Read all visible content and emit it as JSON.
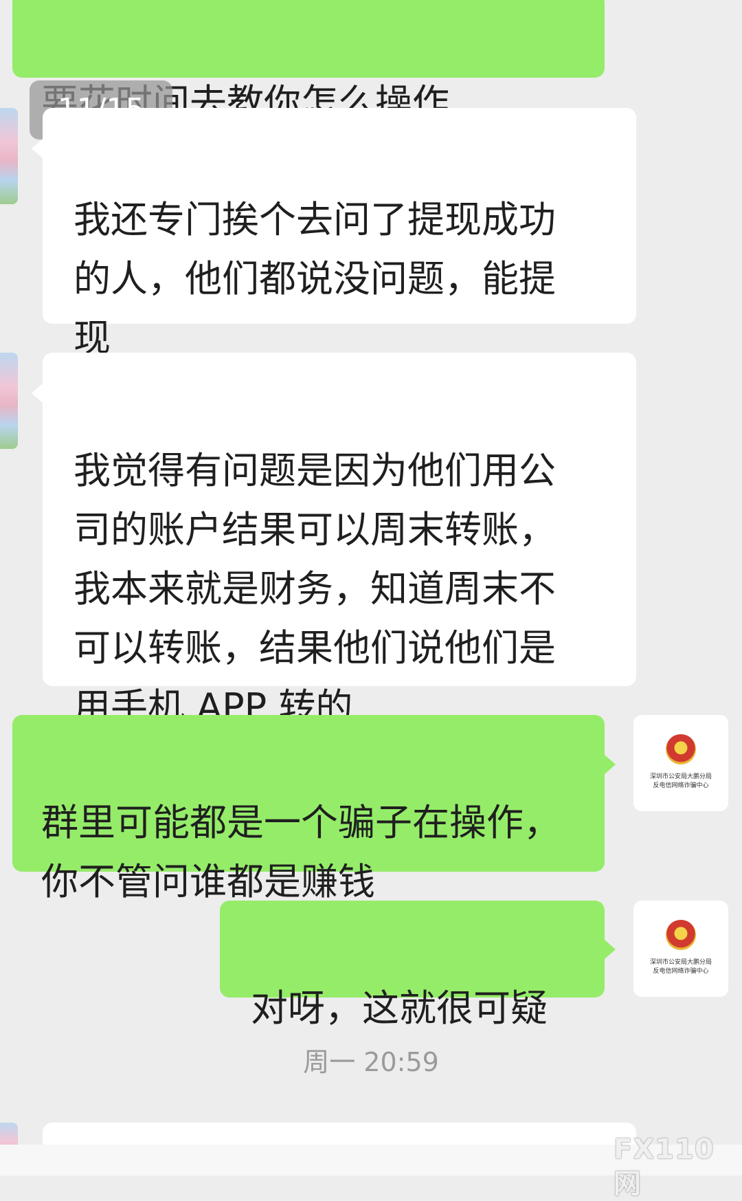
{
  "chat": {
    "page_indicator": "11/15",
    "timestamp": "周一 20:59",
    "messages": [
      {
        "from": "me",
        "text": "要花时间去教你怎么操作"
      },
      {
        "from": "them",
        "text": "我还专门挨个去问了提现成功\n的人，他们都说没问题，能提\n现"
      },
      {
        "from": "them",
        "text": "我觉得有问题是因为他们用公\n司的账户结果可以周末转账，\n我本来就是财务，知道周末不\n可以转账，结果他们说他们是\n用手机 APP 转的"
      },
      {
        "from": "me",
        "text": "群里可能都是一个骗子在操作，\n你不管问谁都是赚钱"
      },
      {
        "from": "me",
        "text": "对呀，这就很可疑"
      }
    ],
    "my_avatar": {
      "icon": "police-emblem-icon",
      "org_text": "深圳市公安局大鹏分局\n反电信网络诈骗中心"
    },
    "contact_avatar": {
      "icon": "cartoon-girl-avatar"
    }
  },
  "watermark": "FX110网",
  "colors": {
    "sent_bubble": "#95ec69",
    "received_bubble": "#ffffff",
    "background": "#ededed"
  }
}
